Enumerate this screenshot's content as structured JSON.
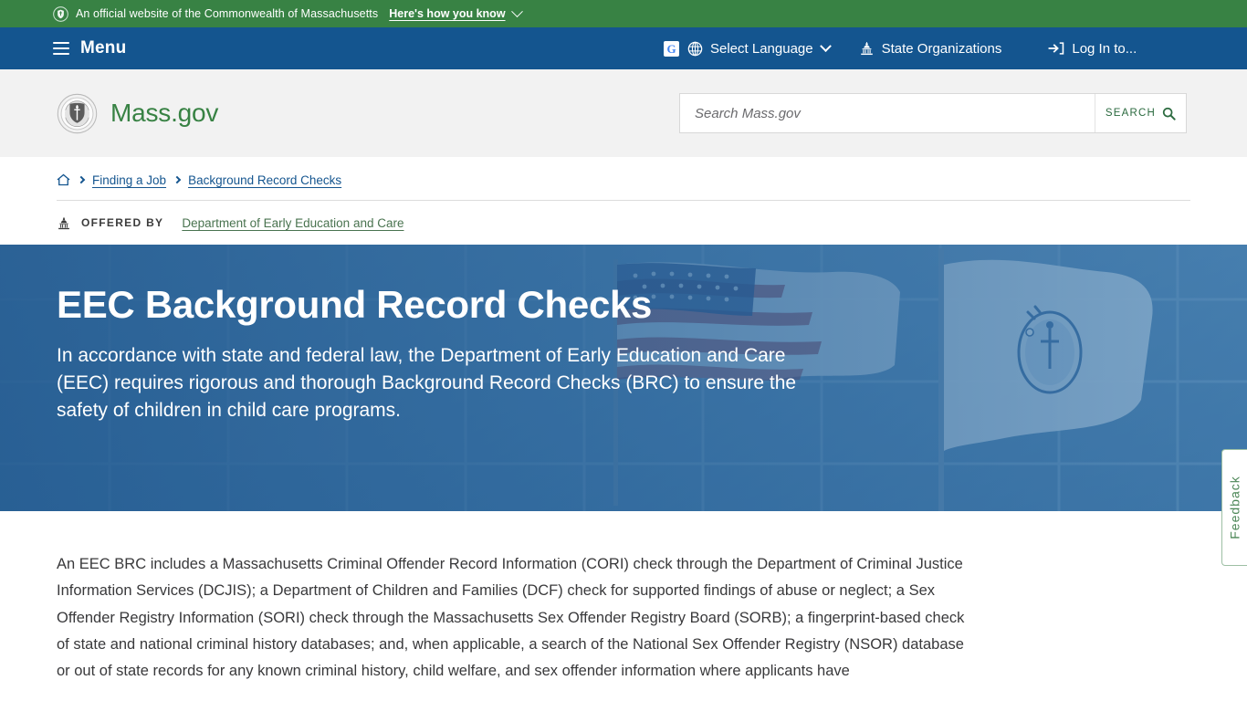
{
  "official_banner": {
    "icon": "shield-icon",
    "text": "An official website of the Commonwealth of Massachusetts",
    "disclosure_label": "Here's how you know",
    "chevron": "chevron-down-icon",
    "background": "#388244"
  },
  "utility_nav": {
    "background": "#14558f",
    "menu_label": "Menu",
    "menu_icon": "hamburger-icon",
    "language": {
      "translate_icon": "google-translate-icon",
      "translate_glyph": "G",
      "globe_icon": "globe-icon",
      "label": "Select Language",
      "chevron": "chevron-down-icon"
    },
    "state_orgs": {
      "icon": "capitol-building-icon",
      "label": "State Organizations"
    },
    "login": {
      "icon": "login-arrow-icon",
      "label": "Log In to..."
    }
  },
  "brand": {
    "seal_icon": "massachusetts-state-seal",
    "name": "Mass.gov",
    "color": "#388244"
  },
  "search": {
    "placeholder": "Search Mass.gov",
    "value": "",
    "button_label": "SEARCH",
    "button_icon": "magnifier-icon"
  },
  "breadcrumb": {
    "home_icon": "home-icon",
    "items": [
      {
        "label": "Finding a Job"
      },
      {
        "label": "Background Record Checks"
      }
    ]
  },
  "offered_by": {
    "icon": "capitol-building-icon",
    "label": "OFFERED BY",
    "organization": "Department of Early Education and Care"
  },
  "hero": {
    "title": "EEC Background Record Checks",
    "subtitle": "In accordance with state and federal law, the Department of Early Education and Care (EEC) requires rigorous and thorough Background Record Checks (BRC) to ensure the safety of children in child care programs.",
    "background_image": "american-flag-and-massachusetts-flag-at-building",
    "overlay_color": "#1d568d"
  },
  "body": {
    "paragraph": "An EEC BRC includes a Massachusetts Criminal Offender Record Information (CORI) check through the Department of Criminal Justice Information Services (DCJIS); a Department of Children and Families (DCF) check for supported findings of abuse or neglect; a Sex Offender Registry Information (SORI) check through the Massachusetts Sex Offender Registry Board (SORB); a fingerprint-based check of state and national criminal history databases; and, when applicable, a search of the National Sex Offender Registry (NSOR) database or out of state records for any known criminal history, child welfare, and sex offender information where applicants have"
  },
  "feedback": {
    "label": "Feedback",
    "color": "#4c8757"
  }
}
